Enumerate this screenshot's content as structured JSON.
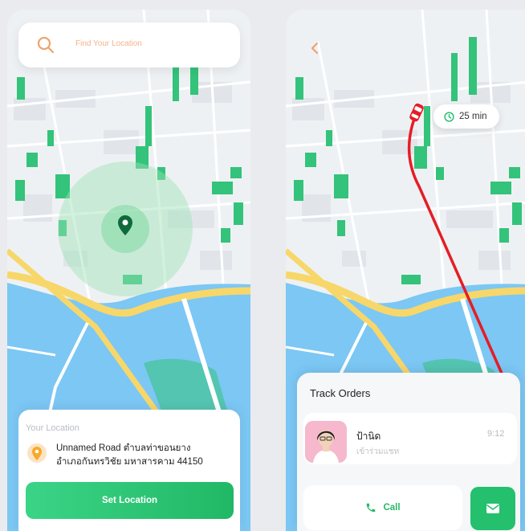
{
  "left_screen": {
    "search": {
      "placeholder": "Find Your Location",
      "icon": "search-icon"
    },
    "location_card": {
      "header": "Your Location",
      "address_line1": "Unnamed Road ตำบลท่าขอนยาง",
      "address_line2": "อำเภอกันทรวิชัย มหาสารคาม 44150",
      "button": "Set Location"
    }
  },
  "right_screen": {
    "eta": "25 min",
    "track_orders": {
      "title": "Track Orders",
      "driver_name": "ป้านิด",
      "driver_status": "เข้าร่วมแชท",
      "time": "9:12",
      "call_label": "Call"
    }
  },
  "colors": {
    "accent_green": "#24c06d",
    "route_red": "#e51d25",
    "search_orange": "#f0a36e",
    "water": "#7cc7f4",
    "road_yellow": "#f7d76a"
  }
}
